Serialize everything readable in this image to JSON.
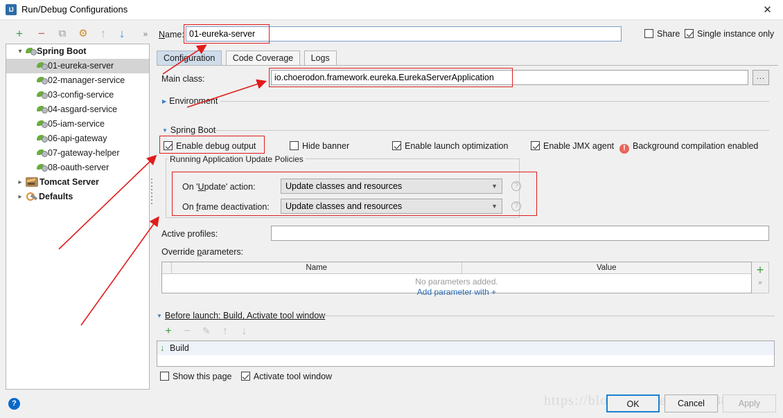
{
  "window": {
    "title": "Run/Debug Configurations",
    "icon": "intellij-idea-icon",
    "close_label": "✕"
  },
  "toolbar": {
    "add": "+",
    "remove": "−",
    "copy": "⧉",
    "edit_templates": "⚙",
    "move_up": "↑",
    "move_down": "↓",
    "overflow": "»"
  },
  "tree": {
    "groups": [
      {
        "label": "Spring Boot",
        "icon": "spring-leaf-icon",
        "expanded": true,
        "children": [
          {
            "label": "01-eureka-server",
            "selected": true
          },
          {
            "label": "02-manager-service",
            "selected": false
          },
          {
            "label": "03-config-service",
            "selected": false
          },
          {
            "label": "04-asgard-service",
            "selected": false
          },
          {
            "label": "05-iam-service",
            "selected": false
          },
          {
            "label": "06-api-gateway",
            "selected": false
          },
          {
            "label": "07-gateway-helper",
            "selected": false
          },
          {
            "label": "08-oauth-server",
            "selected": false
          }
        ]
      },
      {
        "label": "Tomcat Server",
        "icon": "tomcat-icon",
        "expanded": false,
        "children": []
      },
      {
        "label": "Defaults",
        "icon": "wrench-icon",
        "expanded": false,
        "children": []
      }
    ]
  },
  "header": {
    "name_label": "Name:",
    "name_value": "01-eureka-server",
    "share_label": "Share",
    "share_checked": false,
    "single_instance_label": "Single instance only",
    "single_instance_checked": true
  },
  "tabs": [
    {
      "label": "Configuration",
      "active": true
    },
    {
      "label": "Code Coverage",
      "active": false
    },
    {
      "label": "Logs",
      "active": false
    }
  ],
  "configuration": {
    "main_class_label": "Main class:",
    "main_class_value": "io.choerodon.framework.eureka.EurekaServerApplication",
    "browse_button": "...",
    "environment_section": "Environment",
    "spring_boot_section": "Spring Boot",
    "checkboxes": {
      "enable_debug_output": {
        "label": "Enable debug output",
        "checked": true
      },
      "hide_banner": {
        "label": "Hide banner",
        "checked": false
      },
      "enable_launch_optimization": {
        "label": "Enable launch optimization",
        "checked": true
      },
      "enable_jmx_agent": {
        "label": "Enable JMX agent",
        "checked": true
      }
    },
    "background_compilation_warning": "Background compilation enabled",
    "update_policies": {
      "group_title": "Running Application Update Policies",
      "on_update_label": "On 'Update' action:",
      "on_update_value": "Update classes and resources",
      "on_frame_label": "On frame deactivation:",
      "on_frame_value": "Update classes and resources",
      "help_glyph": "?"
    },
    "active_profiles_label": "Active profiles:",
    "active_profiles_value": "",
    "override_parameters_label": "Override parameters:",
    "params_table": {
      "columns": [
        "",
        "Name",
        "Value"
      ],
      "rows": [],
      "empty_text": "No parameters added.",
      "add_link": "Add parameter with +",
      "add_button": "+",
      "expand_button": "»"
    }
  },
  "before_launch": {
    "section_label": "Before launch: Build, Activate tool window",
    "toolbar": {
      "add": "+",
      "remove": "−",
      "edit": "✎",
      "up": "↑",
      "down": "↓"
    },
    "items": [
      {
        "label": "Build",
        "icon": "build-icon"
      }
    ],
    "show_this_page": {
      "label": "Show this page",
      "checked": false
    },
    "activate_tool_window": {
      "label": "Activate tool window",
      "checked": true
    }
  },
  "footer": {
    "help": "?",
    "ok": "OK",
    "cancel": "Cancel",
    "apply": "Apply"
  },
  "watermark": "https://blog.csdn.net/q_269881833",
  "annotations": {
    "color": "#e21b1b",
    "highlight_boxes": [
      "name-field",
      "main-class-value",
      "enable-debug-output",
      "update-policies-group"
    ]
  }
}
